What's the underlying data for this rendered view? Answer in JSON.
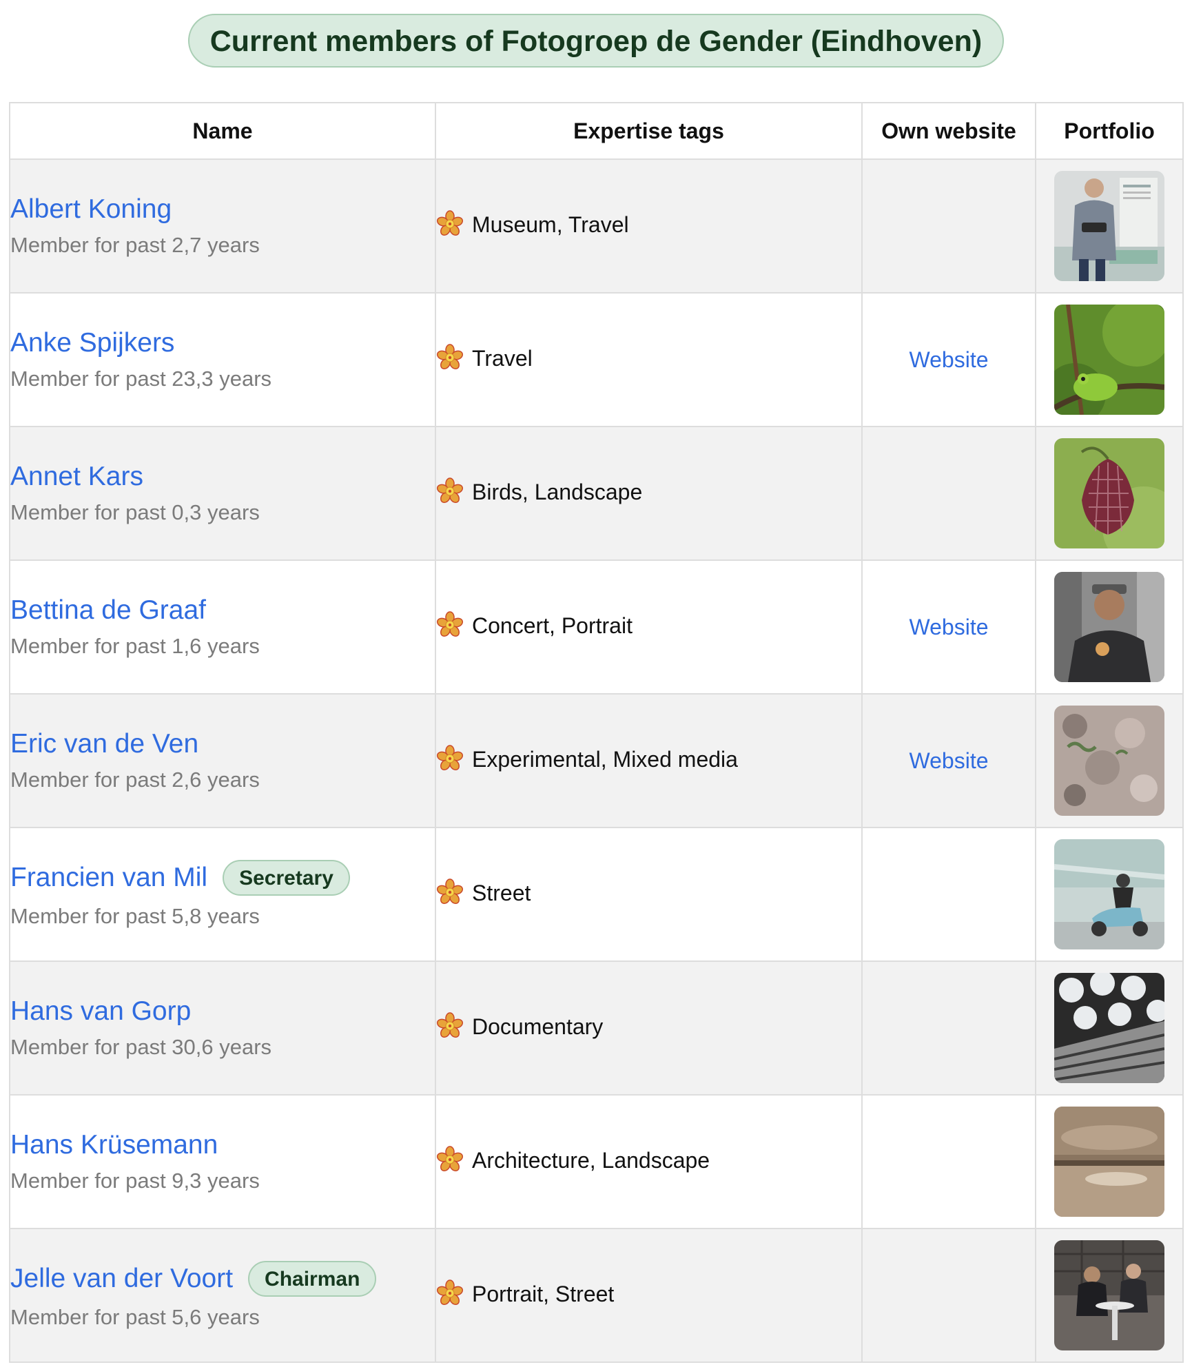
{
  "page": {
    "title": "Current members of Fotogroep de Gender (Eindhoven)"
  },
  "table": {
    "headers": {
      "name": "Name",
      "tags": "Expertise tags",
      "website": "Own website",
      "portfolio": "Portfolio"
    },
    "rows": [
      {
        "name": "Albert Koning",
        "role": "",
        "since": "Member for past 2,7 years",
        "tags": "Museum, Travel",
        "website": "",
        "portfolio_icon": "portfolio-thumbnail-man-with-camera"
      },
      {
        "name": "Anke Spijkers",
        "role": "",
        "since": "Member for past 23,3 years",
        "tags": "Travel",
        "website": "Website",
        "portfolio_icon": "portfolio-thumbnail-tree-frog"
      },
      {
        "name": "Annet Kars",
        "role": "",
        "since": "Member for past 0,3 years",
        "tags": "Birds, Landscape",
        "website": "",
        "portfolio_icon": "portfolio-thumbnail-checkered-lily"
      },
      {
        "name": "Bettina de Graaf",
        "role": "",
        "since": "Member for past 1,6 years",
        "tags": "Concert, Portrait",
        "website": "Website",
        "portfolio_icon": "portfolio-thumbnail-man-portrait"
      },
      {
        "name": "Eric van de Ven",
        "role": "",
        "since": "Member for past 2,6 years",
        "tags": "Experimental, Mixed media",
        "website": "Website",
        "portfolio_icon": "portfolio-thumbnail-texture"
      },
      {
        "name": "Francien van Mil",
        "role": "Secretary",
        "since": "Member for past 5,8 years",
        "tags": "Street",
        "website": "",
        "portfolio_icon": "portfolio-thumbnail-scooter"
      },
      {
        "name": "Hans van Gorp",
        "role": "",
        "since": "Member for past 30,6 years",
        "tags": "Documentary",
        "website": "",
        "portfolio_icon": "portfolio-thumbnail-architecture-circles"
      },
      {
        "name": "Hans Krüsemann",
        "role": "",
        "since": "Member for past 9,3 years",
        "tags": "Architecture, Landscape",
        "website": "",
        "portfolio_icon": "portfolio-thumbnail-sepia-landscape"
      },
      {
        "name": "Jelle van der Voort",
        "role": "Chairman",
        "since": "Member for past 5,6 years",
        "tags": "Portrait, Street",
        "website": "",
        "portfolio_icon": "portfolio-thumbnail-two-women-seated"
      }
    ]
  },
  "icons": {
    "tag": "flower-icon"
  },
  "colors": {
    "link": "#2f6bdf",
    "badge_bg": "#d9ebdf",
    "badge_border": "#a9ceb4",
    "badge_text": "#16391f",
    "muted": "#7b7b7b",
    "row_alt": "#f2f2f2"
  }
}
